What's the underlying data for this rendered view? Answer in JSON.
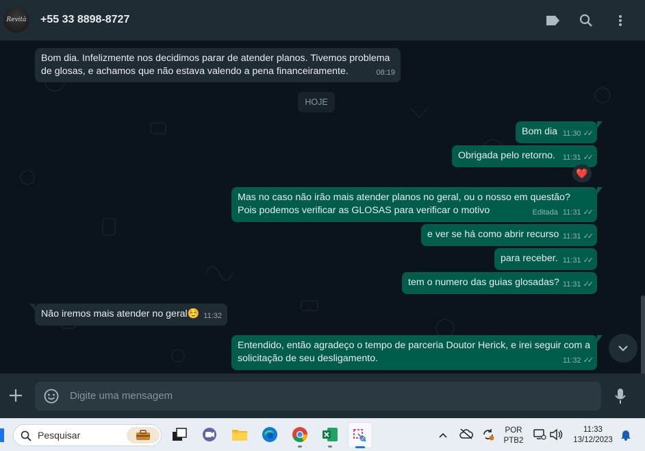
{
  "header": {
    "avatar_text": "Revità",
    "contact_name": "+55 33 8898-8727"
  },
  "chat": {
    "date_divider": "HOJE",
    "messages": [
      {
        "dir": "in",
        "text": "Bom dia. Infelizmente nos decidimos parar de atender planos. Tivemos problema de glosas, e achamos que não estava valendo a pena financeiramente.",
        "time": "08:19"
      },
      {
        "dir": "out",
        "text": "Bom dia",
        "time": "11:30"
      },
      {
        "dir": "out",
        "text": "Obrigada pelo retorno.",
        "time": "11:31",
        "reaction": "❤️"
      },
      {
        "dir": "out",
        "text": "Mas no caso não irão mais atender planos no geral, ou o nosso em questão? Pois podemos verificar as GLOSAS para verificar o motivo",
        "edited_label": "Editada",
        "time": "11:31"
      },
      {
        "dir": "out",
        "text": "e ver se há como abrir recurso",
        "time": "11:31"
      },
      {
        "dir": "out",
        "text": "para receber.",
        "time": "11:31"
      },
      {
        "dir": "out",
        "text": "tem o numero das guias glosadas?",
        "time": "11:31"
      },
      {
        "dir": "in",
        "text": "Não iremos mais atender no geral☺️",
        "time": "11:32"
      },
      {
        "dir": "out",
        "text": "Entendido, então agradeço o tempo de parceria Doutor Herick, e irei seguir com a solicitação de seu desligamento.",
        "time": "11:32"
      }
    ]
  },
  "composer": {
    "placeholder": "Digite uma mensagem"
  },
  "taskbar": {
    "search_placeholder": "Pesquisar",
    "language_line1": "POR",
    "language_line2": "PTB2",
    "clock_time": "11:33",
    "clock_date": "13/12/2023"
  },
  "colors": {
    "incoming_bubble": "#202c33",
    "outgoing_bubble": "#005c4b",
    "chat_background": "#0b141a",
    "header": "#202c33"
  }
}
